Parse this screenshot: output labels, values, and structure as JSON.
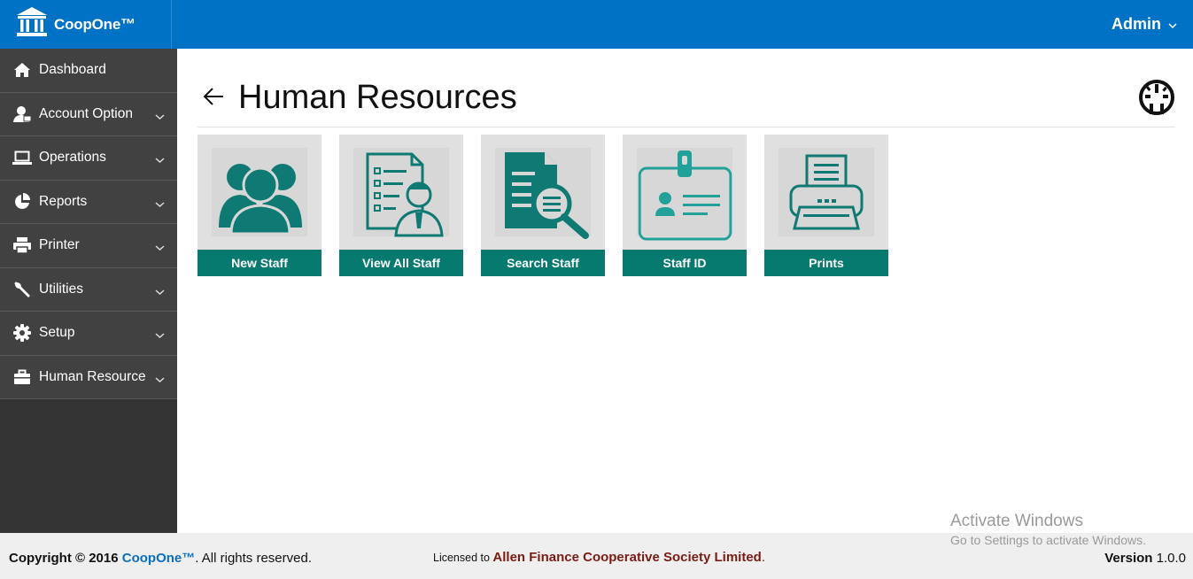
{
  "app": {
    "brand": "CoopOne™"
  },
  "header": {
    "user_label": "Admin"
  },
  "sidebar": {
    "items": [
      {
        "label": "Dashboard",
        "icon": "home-icon"
      },
      {
        "label": "Account Option",
        "icon": "user-icon"
      },
      {
        "label": "Operations",
        "icon": "laptop-icon"
      },
      {
        "label": "Reports",
        "icon": "pie-chart-icon"
      },
      {
        "label": "Printer",
        "icon": "printer-icon"
      },
      {
        "label": "Utilities",
        "icon": "wrench-icon"
      },
      {
        "label": "Setup",
        "icon": "gear-icon"
      },
      {
        "label": "Human Resource",
        "icon": "briefcase-icon"
      }
    ]
  },
  "page": {
    "title": "Human Resources"
  },
  "tiles": [
    {
      "label": "New Staff",
      "icon": "users-group-icon"
    },
    {
      "label": "View All Staff",
      "icon": "staff-list-icon"
    },
    {
      "label": "Search Staff",
      "icon": "document-search-icon"
    },
    {
      "label": "Staff ID",
      "icon": "id-card-icon"
    },
    {
      "label": "Prints",
      "icon": "printer-icon"
    }
  ],
  "footer": {
    "copyright_prefix": "Copyright © 2016",
    "brand": "CoopOne™",
    "copyright_suffix": ". All rights reserved.",
    "licensed_prefix": "Licensed to",
    "licensee": "Allen Finance Cooperative Society Limited",
    "licensed_suffix": ".",
    "version_label": "Version",
    "version_value": "1.0.0"
  },
  "watermark": {
    "line1": "Activate Windows",
    "line2": "Go to Settings to activate Windows."
  },
  "colors": {
    "topbar": "#0072c6",
    "sidebar": "#414141",
    "tile_accent": "#077a70",
    "licensee": "#7b1c14"
  }
}
